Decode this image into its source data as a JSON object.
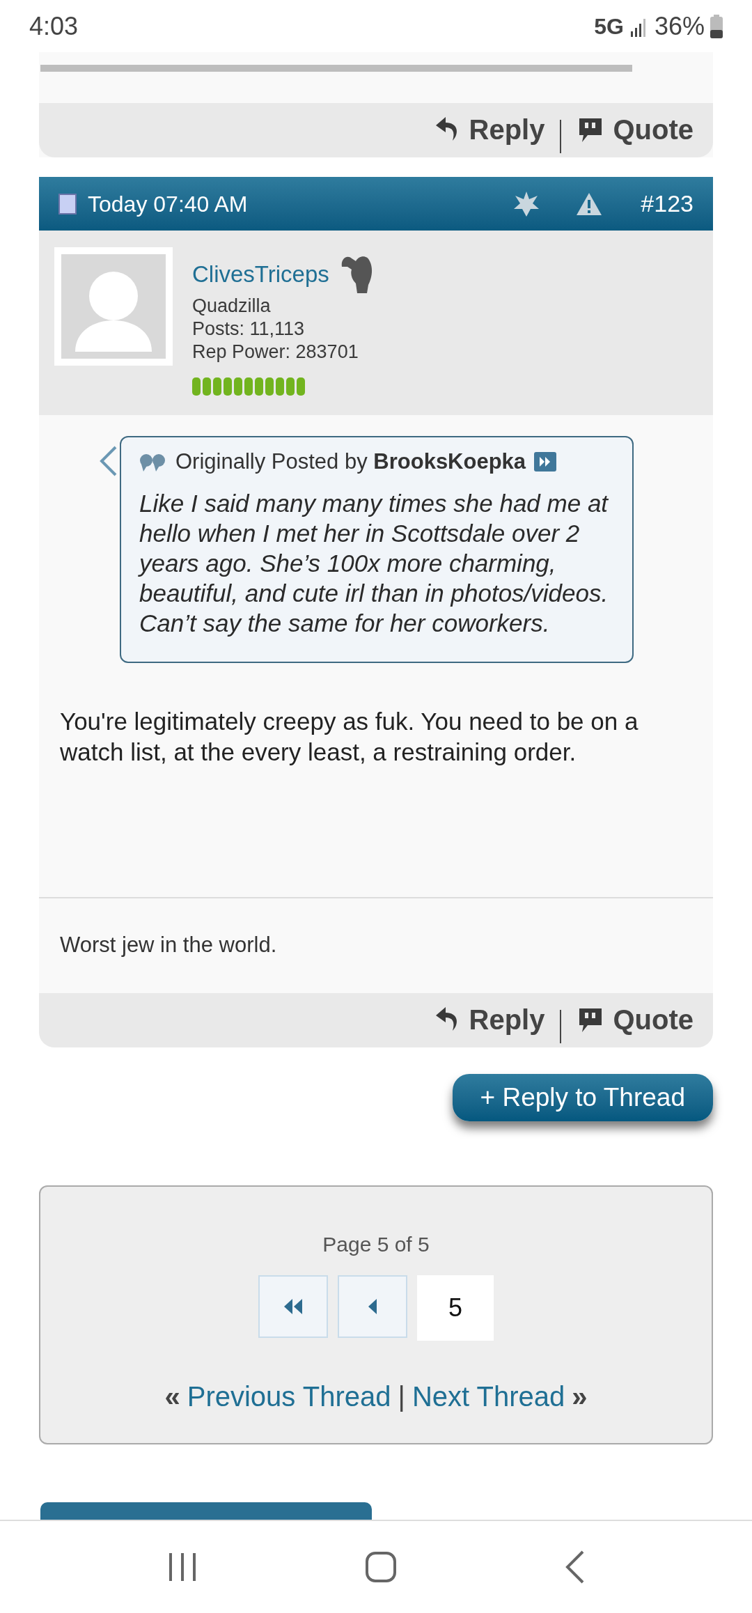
{
  "status_bar": {
    "time": "4:03",
    "network": "5G",
    "battery": "36%"
  },
  "previous_post": {
    "actions": [
      "Reply",
      "Quote"
    ]
  },
  "post": {
    "date": "Today 07:40 AM",
    "number": "#123",
    "user": {
      "name": "ClivesTriceps",
      "title": "Quadzilla",
      "posts": "Posts: 11,113",
      "rep_power": "Rep Power: 283701"
    },
    "quote": {
      "prefix": "Originally Posted by",
      "author": "BrooksKoepka",
      "text": "Like I said many many times she had me at hello when I met her in Scottsdale over 2 years ago. She’s 100x more charming, beautiful, and cute irl than in photos/videos. Can’t say the same for her coworkers."
    },
    "message": "You're legitimately creepy as fuk. You need to be on a watch list, at the every least, a restraining order.",
    "signature": "Worst jew in the world.",
    "actions": [
      "Reply",
      "Quote"
    ]
  },
  "reply_button": "+ Reply to Thread",
  "pagination": {
    "label": "Page 5 of 5",
    "current_page": "5",
    "prev_marker": "«",
    "previous_thread": "Previous Thread",
    "separator": "|",
    "next_thread": "Next Thread",
    "next_marker": "»"
  }
}
